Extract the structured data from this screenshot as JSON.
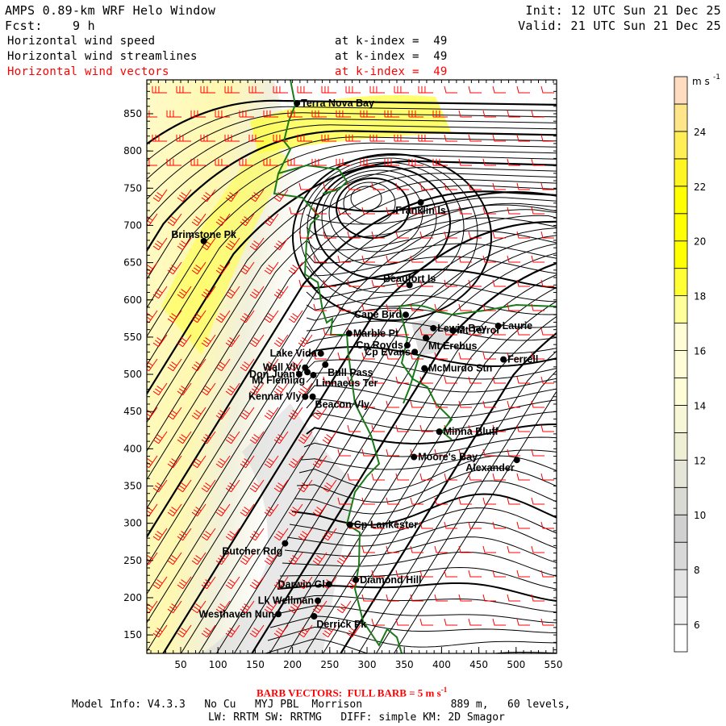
{
  "header": {
    "title": "AMPS 0.89-km WRF Helo Window",
    "fcst": "Fcst:    9 h",
    "init": "Init: 12 UTC Sun 21 Dec 25",
    "valid": "Valid: 21 UTC Sun 21 Dec 25",
    "fields": [
      {
        "name": "Horizontal wind speed",
        "level": "at k-index =  49"
      },
      {
        "name": "Horizontal wind streamlines",
        "level": "at k-index =  49"
      },
      {
        "name": "Horizontal wind vectors",
        "level": "at k-index =  49"
      }
    ]
  },
  "colors": {
    "vectors": "#ff0000",
    "coast": "#1a7a1a",
    "stations": "#000000"
  },
  "map": {
    "x_ticks": [
      "50",
      "100",
      "150",
      "200",
      "250",
      "300",
      "350",
      "400",
      "450",
      "500",
      "550"
    ],
    "y_ticks": [
      "850",
      "800",
      "750",
      "700",
      "650",
      "600",
      "550",
      "500",
      "450",
      "400",
      "350",
      "300",
      "250",
      "200",
      "150"
    ],
    "stations": [
      {
        "name": "Terra Nova Bay",
        "x": 206,
        "y": 864,
        "anchor": "r"
      },
      {
        "name": "Franklin Is",
        "x": 372,
        "y": 731,
        "anchor": "b"
      },
      {
        "name": "Brimstone Pk",
        "x": 81,
        "y": 679,
        "anchor": "t"
      },
      {
        "name": "Beaufort Is",
        "x": 357,
        "y": 620,
        "anchor": "t"
      },
      {
        "name": "Cape Bird",
        "x": 352,
        "y": 580,
        "anchor": "l"
      },
      {
        "name": "Marble Pt",
        "x": 276,
        "y": 555,
        "anchor": "r"
      },
      {
        "name": "Lewis Bay",
        "x": 389,
        "y": 562,
        "anchor": "r"
      },
      {
        "name": "Mt Terror",
        "x": 415,
        "y": 559,
        "anchor": "r"
      },
      {
        "name": "Laurie",
        "x": 476,
        "y": 565,
        "anchor": "r"
      },
      {
        "name": "Cp Royds",
        "x": 354,
        "y": 539,
        "anchor": "l"
      },
      {
        "name": "Mt Erebus",
        "x": 379,
        "y": 549,
        "anchor": "br"
      },
      {
        "name": "Cp Evans",
        "x": 364,
        "y": 530,
        "anchor": "l"
      },
      {
        "name": "Ferrell",
        "x": 483,
        "y": 520,
        "anchor": "r"
      },
      {
        "name": "McMurdo Stn",
        "x": 377,
        "y": 508,
        "anchor": "r"
      },
      {
        "name": "Lake Vida",
        "x": 238,
        "y": 528,
        "anchor": "l"
      },
      {
        "name": "Wall Vly",
        "x": 217,
        "y": 509,
        "anchor": "l"
      },
      {
        "name": "Bull Pass",
        "x": 244,
        "y": 513,
        "anchor": "br"
      },
      {
        "name": "Don Juan",
        "x": 209,
        "y": 500,
        "anchor": "l"
      },
      {
        "name": "Mt Fleming",
        "x": 220,
        "y": 503,
        "anchor": "bl"
      },
      {
        "name": "Linnaeus Ter",
        "x": 228,
        "y": 499,
        "anchor": "br"
      },
      {
        "name": "Kennar Vly",
        "x": 217,
        "y": 470,
        "anchor": "l"
      },
      {
        "name": "Beacon Vly",
        "x": 227,
        "y": 470,
        "anchor": "br"
      },
      {
        "name": "Minna Bluff",
        "x": 397,
        "y": 423,
        "anchor": "r"
      },
      {
        "name": "Moore's Bay",
        "x": 363,
        "y": 389,
        "anchor": "r"
      },
      {
        "name": "Alexander",
        "x": 501,
        "y": 385,
        "anchor": "bl"
      },
      {
        "name": "Cp Lankester",
        "x": 277,
        "y": 298,
        "anchor": "r"
      },
      {
        "name": "Butcher Rdg",
        "x": 190,
        "y": 273,
        "anchor": "bl"
      },
      {
        "name": "Darwin Gl",
        "x": 249,
        "y": 218,
        "anchor": "l"
      },
      {
        "name": "Diamond Hill",
        "x": 285,
        "y": 224,
        "anchor": "r"
      },
      {
        "name": "Lk Wellman",
        "x": 234,
        "y": 196,
        "anchor": "l"
      },
      {
        "name": "Westhaven Nun",
        "x": 181,
        "y": 178,
        "anchor": "l"
      },
      {
        "name": "Derrick Pk",
        "x": 229,
        "y": 175,
        "anchor": "br"
      }
    ]
  },
  "colorbar": {
    "units": "m s",
    "units_exp": "-1",
    "levels": [
      5,
      6,
      7,
      8,
      9,
      10,
      11,
      12,
      13,
      14,
      15,
      16,
      17,
      18,
      19,
      20,
      21,
      22,
      23,
      24,
      25,
      26
    ],
    "colors": [
      "#ffffff",
      "#f2f2f2",
      "#e4e4e4",
      "#d8d8d8",
      "#d0d0d0",
      "#dadad4",
      "#e6e6d8",
      "#efefd6",
      "#f7f7d8",
      "#fffdd6",
      "#fffdd8",
      "#fffcd6",
      "#ffff99",
      "#ffff33",
      "#ffff00",
      "#ffff00",
      "#ffff00",
      "#fff522",
      "#ffee55",
      "#ffe58a",
      "#ffdcc0"
    ],
    "labels": [
      "6",
      "8",
      "10",
      "12",
      "14",
      "16",
      "18",
      "20",
      "22",
      "24"
    ]
  },
  "footer": {
    "barb_note": "BARB VECTORS:  FULL BARB = 5 m s",
    "barb_exp": "-1",
    "model_info": "Model Info: V4.3.3   No Cu   MYJ PBL  Morrison              889 m,   60 levels,",
    "physics": "LW: RRTM SW: RRTMG   DIFF: simple KM: 2D Smagor"
  }
}
